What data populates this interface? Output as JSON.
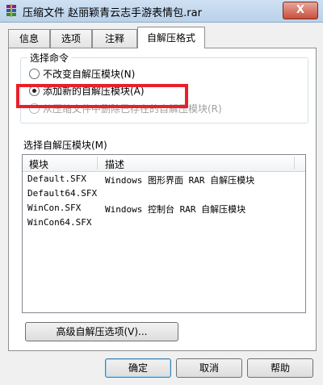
{
  "window": {
    "title": "压缩文件 赵丽颖青云志手游表情包.rar",
    "close_label": "X"
  },
  "tabs": [
    {
      "label": "信息"
    },
    {
      "label": "选项"
    },
    {
      "label": "注释"
    },
    {
      "label": "自解压格式",
      "active": true
    }
  ],
  "command_group": {
    "title": "选择命令",
    "options": [
      {
        "label": "不改变自解压模块(N)",
        "selected": false,
        "enabled": true
      },
      {
        "label": "添加新的自解压模块(A)",
        "selected": true,
        "enabled": true
      },
      {
        "label": "从压缩文件中删除已存在的自解压模块(R)",
        "selected": false,
        "enabled": false
      }
    ]
  },
  "modules": {
    "label": "选择自解压模块(M)",
    "columns": [
      "模块",
      "描述"
    ],
    "rows": [
      {
        "module": "Default.SFX",
        "description": "Windows 图形界面 RAR 自解压模块"
      },
      {
        "module": "Default64.SFX",
        "description": ""
      },
      {
        "module": "WinCon.SFX",
        "description": "Windows 控制台 RAR 自解压模块"
      },
      {
        "module": "WinCon64.SFX",
        "description": ""
      }
    ]
  },
  "advanced_button": "高级自解压选项(V)...",
  "footer": {
    "ok": "确定",
    "cancel": "取消",
    "help": "帮助"
  },
  "colors": {
    "highlight_box": "#e8202a",
    "title_bar": "#cfe0f2"
  }
}
